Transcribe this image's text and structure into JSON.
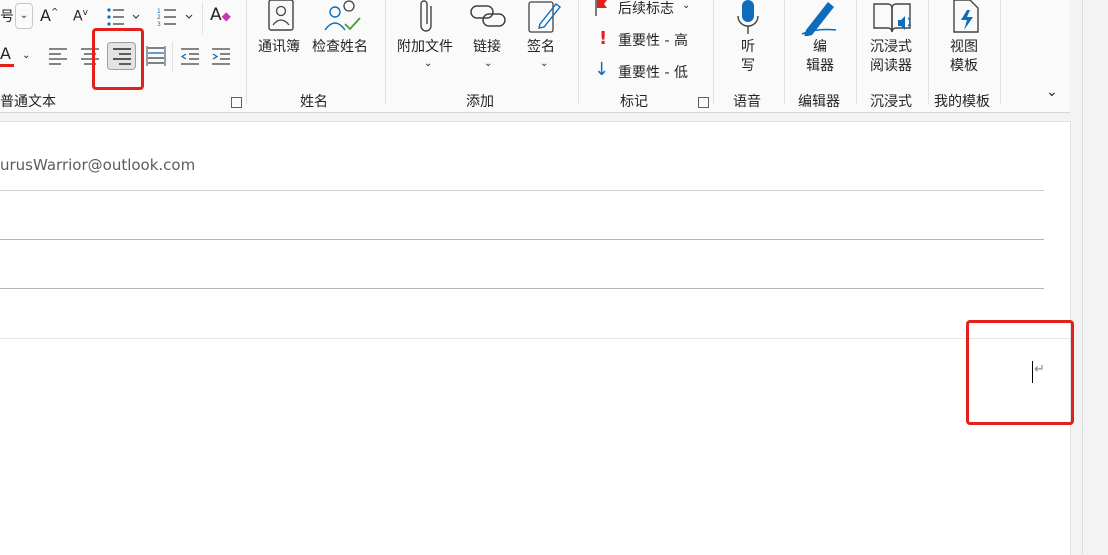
{
  "ribbon": {
    "basic_text": {
      "font_size_partial": "号",
      "group_label": "普通文本"
    },
    "names": {
      "address_book": "通讯簿",
      "check_names": "检查姓名",
      "group_label": "姓名"
    },
    "include": {
      "attach_file": "附加文件",
      "link": "链接",
      "signature": "签名",
      "group_label": "添加"
    },
    "tags": {
      "follow_up": "后续标志",
      "high_importance": "重要性 - 高",
      "low_importance": "重要性 - 低",
      "group_label": "标记"
    },
    "voice": {
      "dictate_line1": "听",
      "dictate_line2": "写",
      "group_label": "语音"
    },
    "editor": {
      "label_line1": "编",
      "label_line2": "辑器",
      "group_label": "编辑器"
    },
    "immersive": {
      "label_line1": "沉浸式",
      "label_line2": "阅读器",
      "group_label": "沉浸式"
    },
    "templates": {
      "label_line1": "视图",
      "label_line2": "模板",
      "group_label": "我的模板"
    }
  },
  "message": {
    "from_partial": "urusWarrior@outlook.com"
  },
  "colors": {
    "accent": "#0f6cbd",
    "highlight": "#e3211c",
    "font_color_bar": "#e3211c"
  }
}
